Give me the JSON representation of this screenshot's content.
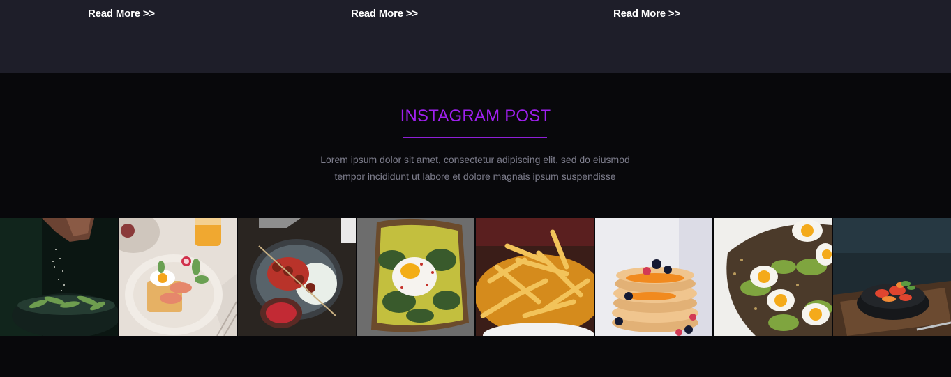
{
  "read_more": {
    "items": [
      "Read More >>",
      "Read More >>",
      "Read More >>"
    ]
  },
  "instagram": {
    "title": "INSTAGRAM POST",
    "description_line1": "Lorem ipsum dolor sit amet, consectetur adipiscing elit, sed do eiusmod",
    "description_line2": "tempor incididunt ut labore et dolore magnais ipsum suspendisse"
  },
  "colors": {
    "top_band": "#1e1e29",
    "section_bg": "#08080b",
    "accent": "#a020f0",
    "body_text": "#7d7d8c"
  },
  "gallery": {
    "photos": [
      "salt-on-green-beans-photo",
      "fig-egg-toast-plate-photo",
      "skewers-and-rice-bowl-photo",
      "avocado-toast-poached-egg-photo",
      "french-fries-bowl-photo",
      "pancake-stack-berries-photo",
      "avocado-egg-toast-photo",
      "salad-bowl-on-board-photo"
    ]
  }
}
